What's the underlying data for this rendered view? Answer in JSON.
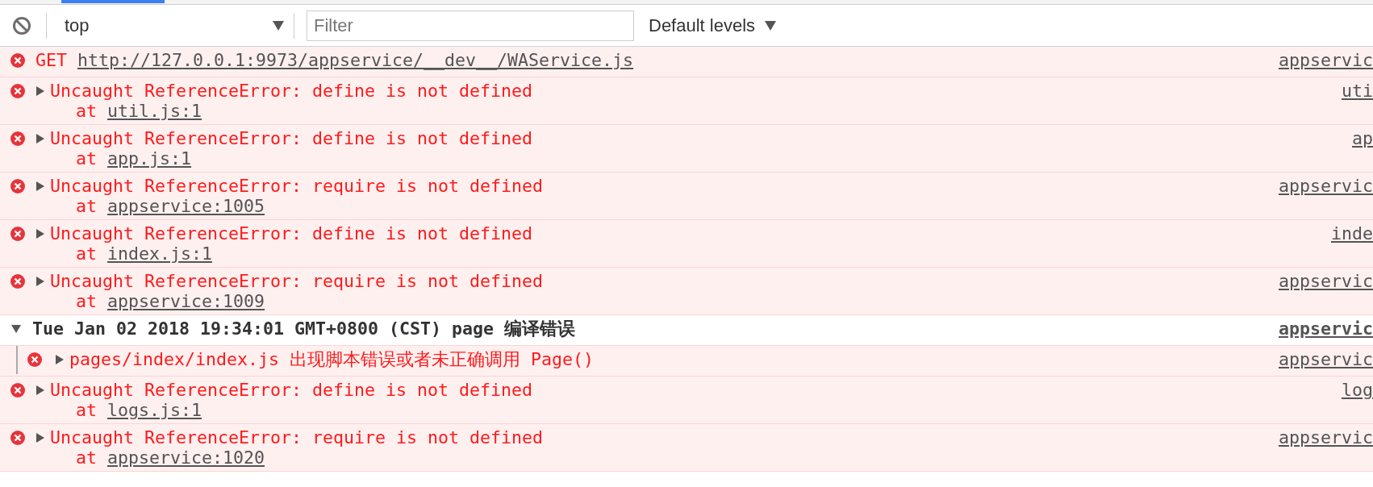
{
  "toolbar": {
    "context": "top",
    "filter": {
      "placeholder": "Filter"
    },
    "levels": "Default levels"
  },
  "messages": [
    {
      "kind": "error",
      "method": "GET",
      "url": "http://127.0.0.1:9973/appservice/__dev__/WAService.js",
      "source": "appservic"
    },
    {
      "kind": "error",
      "expanded": false,
      "text": "Uncaught ReferenceError: define is not defined",
      "stack": [
        {
          "prefix": "at",
          "link": "util.js:1"
        }
      ],
      "source": "uti"
    },
    {
      "kind": "error",
      "expanded": false,
      "text": "Uncaught ReferenceError: define is not defined",
      "stack": [
        {
          "prefix": "at",
          "link": "app.js:1"
        }
      ],
      "source": "ap"
    },
    {
      "kind": "error",
      "expanded": false,
      "text": "Uncaught ReferenceError: require is not defined",
      "stack": [
        {
          "prefix": "at",
          "link": "appservice:1005"
        }
      ],
      "source": "appservic"
    },
    {
      "kind": "error",
      "expanded": false,
      "text": "Uncaught ReferenceError: define is not defined",
      "stack": [
        {
          "prefix": "at",
          "link": "index.js:1"
        }
      ],
      "source": "inde"
    },
    {
      "kind": "error",
      "expanded": false,
      "text": "Uncaught ReferenceError: require is not defined",
      "stack": [
        {
          "prefix": "at",
          "link": "appservice:1009"
        }
      ],
      "source": "appservic"
    },
    {
      "kind": "group",
      "expanded": true,
      "text": "Tue Jan 02 2018 19:34:01 GMT+0800 (CST) page 编译错误",
      "source": "appservic",
      "children": [
        {
          "kind": "error",
          "expanded": false,
          "text": "pages/index/index.js 出现脚本错误或者未正确调用 Page()",
          "source": "appservic"
        }
      ]
    },
    {
      "kind": "error",
      "expanded": false,
      "text": "Uncaught ReferenceError: define is not defined",
      "stack": [
        {
          "prefix": "at",
          "link": "logs.js:1"
        }
      ],
      "source": "log"
    },
    {
      "kind": "error",
      "expanded": false,
      "text": "Uncaught ReferenceError: require is not defined",
      "stack": [
        {
          "prefix": "at",
          "link": "appservice:1020"
        }
      ],
      "source": "appservic"
    }
  ]
}
